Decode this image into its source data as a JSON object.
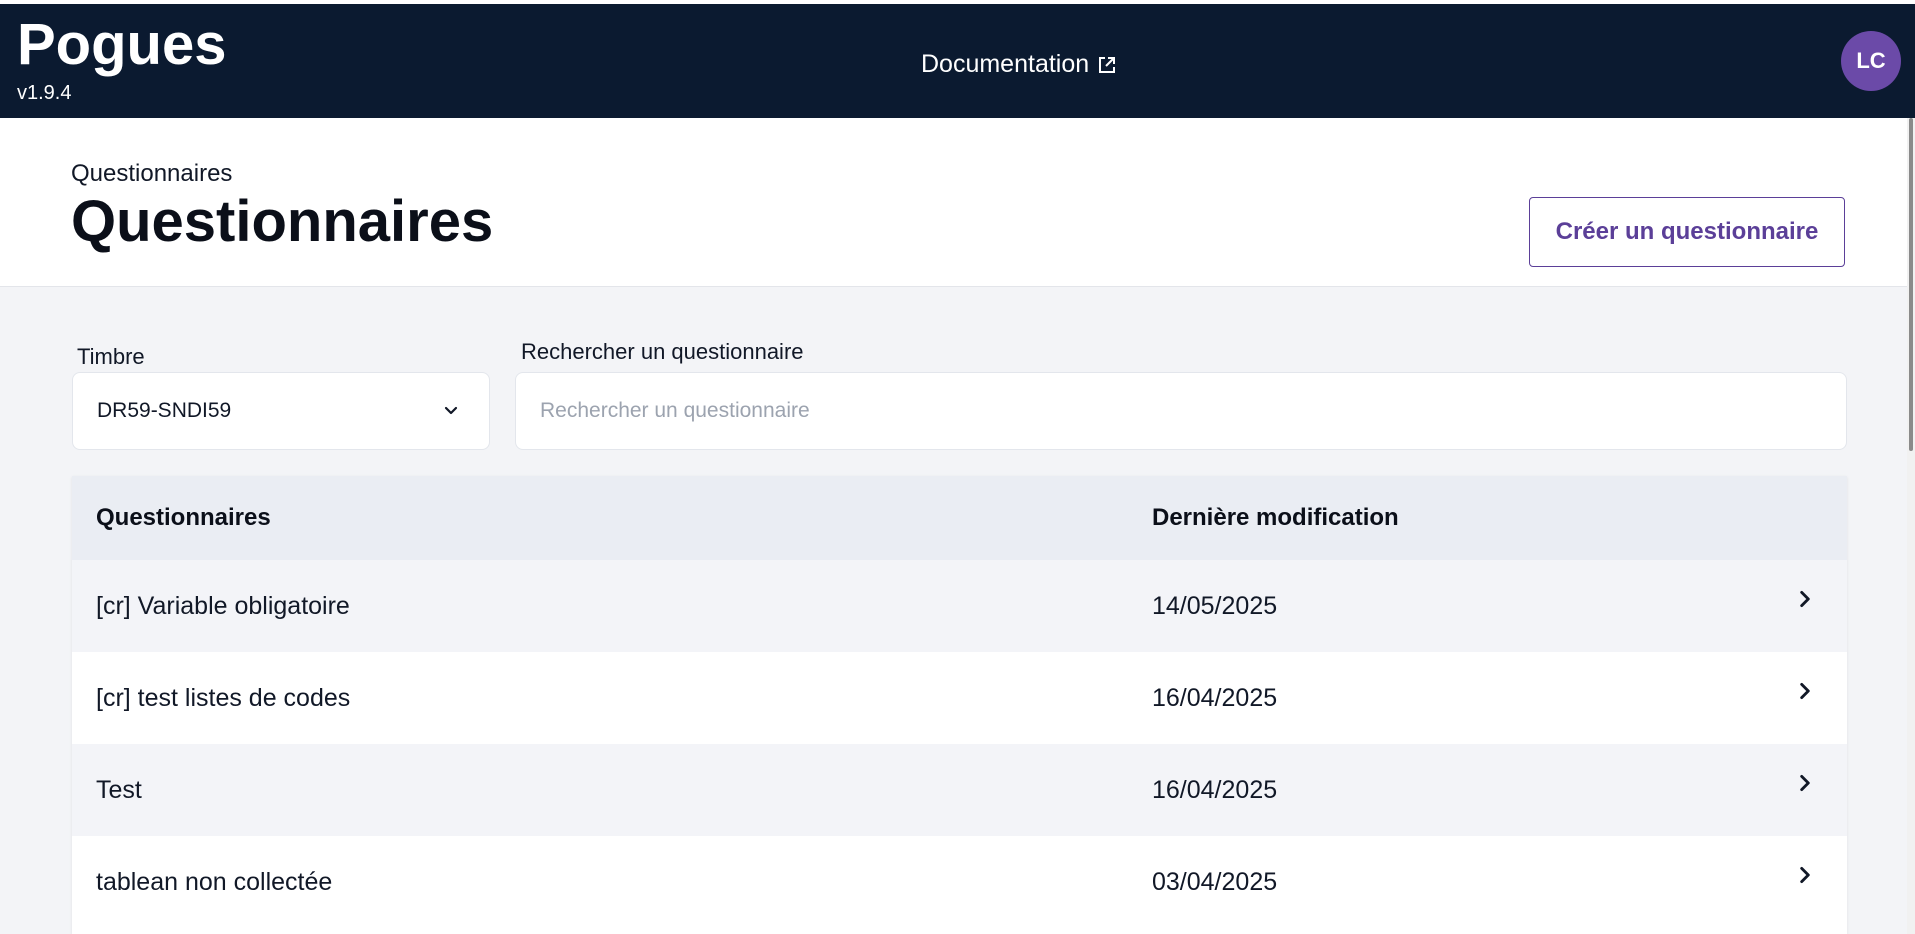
{
  "header": {
    "app_name": "Pogues",
    "version": "v1.9.4",
    "doc_link": "Documentation",
    "avatar_initials": "LC"
  },
  "page": {
    "breadcrumb": "Questionnaires",
    "title": "Questionnaires",
    "create_button": "Créer un questionnaire"
  },
  "filters": {
    "timbre_label": "Timbre",
    "timbre_value": "DR59-SNDI59",
    "search_label": "Rechercher un questionnaire",
    "search_placeholder": "Rechercher un questionnaire",
    "search_value": ""
  },
  "table": {
    "columns": [
      "Questionnaires",
      "Dernière modification"
    ],
    "rows": [
      {
        "name": "[cr] Variable obligatoire",
        "date": "14/05/2025"
      },
      {
        "name": "[cr] test listes de codes",
        "date": "16/04/2025"
      },
      {
        "name": "Test",
        "date": "16/04/2025"
      },
      {
        "name": "tablean non collectée",
        "date": "03/04/2025"
      }
    ]
  },
  "colors": {
    "header_bg": "#0b1a30",
    "accent": "#5b3f98",
    "avatar_bg": "#6b4aa8",
    "page_bg": "#f3f4f7"
  },
  "icons": {
    "doc_link": "external-link-icon",
    "select": "chevron-down-icon",
    "row": "chevron-right-icon"
  }
}
